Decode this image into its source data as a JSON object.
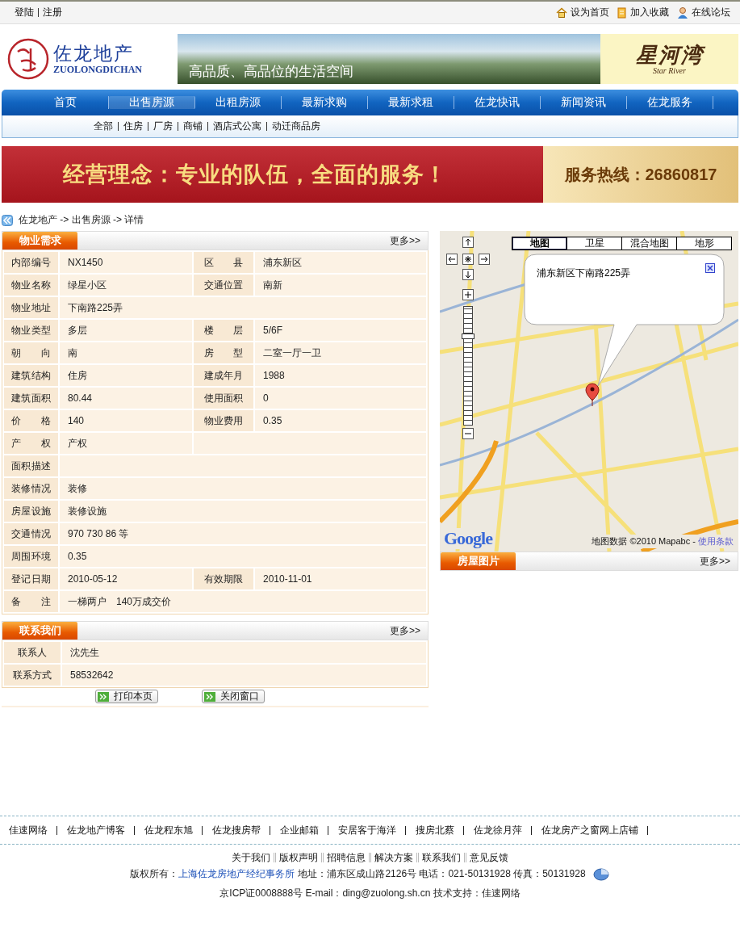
{
  "top_bar": {
    "left_links": [
      "登陆",
      "注册"
    ],
    "right_links": [
      "设为首页",
      "加入收藏",
      "在线论坛"
    ]
  },
  "header": {
    "logo_name": "佐龙地产",
    "logo_pinyin": "ZUOLONGDICHAN",
    "banner_caption": "高品质、高品位的生活空间",
    "brand_name": "星河湾",
    "brand_tagline": "Star River"
  },
  "nav": [
    {
      "label": "首页",
      "selected": false
    },
    {
      "label": "出售房源",
      "selected": true
    },
    {
      "label": "出租房源",
      "selected": false
    },
    {
      "label": "最新求购",
      "selected": false
    },
    {
      "label": "最新求租",
      "selected": false
    },
    {
      "label": "佐龙快讯",
      "selected": false
    },
    {
      "label": "新闻资讯",
      "selected": false
    },
    {
      "label": "佐龙服务",
      "selected": false
    }
  ],
  "sub_nav": [
    "全部",
    "住房",
    "厂房",
    "商铺",
    "酒店式公寓",
    "动迁商品房"
  ],
  "promo_banner": {
    "slogan": "经营理念：专业的队伍，全面的服务！",
    "hotline": "服务热线：26860817"
  },
  "breadcrumb": "佐龙地产 -> 出售房源 -> 详情",
  "property_panel": {
    "title": "物业需求",
    "more": "更多>>",
    "rows": [
      {
        "kind": "pair",
        "label": "内部编号",
        "value": "NX1450",
        "label_2": "区　县",
        "value_2": "浦东新区"
      },
      {
        "kind": "pair",
        "label": "物业名称",
        "value": "绿星小区",
        "label_2": "交通位置",
        "value_2": "南新"
      },
      {
        "kind": "wide",
        "label": "物业地址",
        "value": "下南路225弄"
      },
      {
        "kind": "pair",
        "label": "物业类型",
        "value": "多层",
        "label_2": "楼　层",
        "value_2": "5/6F"
      },
      {
        "kind": "pair",
        "label": "朝　向",
        "value": "南",
        "label_2": "房　型",
        "value_2": "二室一厅一卫"
      },
      {
        "kind": "pair",
        "label": "建筑结构",
        "value": "住房",
        "label_2": "建成年月",
        "value_2": "1988"
      },
      {
        "kind": "pair",
        "label": "建筑面积",
        "value": "80.44",
        "label_2": "使用面积",
        "value_2": "0"
      },
      {
        "kind": "pair",
        "label": "价　格",
        "value": "140",
        "label_2": "物业费用",
        "value_2": "0.35"
      },
      {
        "kind": "half",
        "label": "产　权",
        "value": "产权"
      },
      {
        "kind": "wide",
        "label": "面积描述"
      },
      {
        "kind": "wide",
        "label": "装修情况",
        "value": "装修"
      },
      {
        "kind": "wide",
        "label": "房屋设施",
        "value": "装修设施"
      },
      {
        "kind": "wide",
        "label": "交通情况",
        "value": "970 730 86 等"
      },
      {
        "kind": "wide",
        "label": "周围环境",
        "value": "0.35"
      },
      {
        "kind": "pair",
        "label": "登记日期",
        "value": "2010-05-12",
        "label_2": "有效期限",
        "value_2": "2010-11-01"
      },
      {
        "kind": "wide",
        "label": "备　注",
        "value": "一梯两户　140万成交价"
      }
    ]
  },
  "contact_panel": {
    "title": "联系我们",
    "more": "更多>>",
    "rows": [
      {
        "label": "联系人",
        "value": "沈先生"
      },
      {
        "label": "联系方式",
        "value": "58532642"
      }
    ]
  },
  "buttons": [
    "打印本页",
    "关闭窗口"
  ],
  "map_panel": {
    "map_types": [
      {
        "label": "地图",
        "selected": true
      },
      {
        "label": "卫星",
        "selected": false
      },
      {
        "label": "混合地图",
        "selected": false
      },
      {
        "label": "地形",
        "selected": false
      }
    ],
    "zoom_slider": {
      "level": 0.76
    },
    "info_window": "浦东新区下南路225弄",
    "logo": "Google",
    "attribution": "地图数据 ©2010 Mapabc - ",
    "terms_link": "使用条款"
  },
  "photos_panel": {
    "title": "房屋图片",
    "more": "更多>>"
  },
  "footer": {
    "links": [
      "佳速网络",
      "佐龙地产博客",
      "佐龙程东旭",
      "佐龙搜房帮",
      "企业邮箱",
      "安居客于海洋",
      "搜房北蔡",
      "佐龙徐月萍",
      "佐龙房产之窗网上店铺"
    ],
    "info_links": [
      "关于我们",
      "版权声明",
      "招聘信息",
      "解决方案",
      "联系我们",
      "意见反馈"
    ],
    "copyright_label": "版权所有：",
    "company_link": "上海佐龙房地产经纪事务所",
    "address": "地址：浦东区成山路2126号 电话：021-50131928 传真：50131928",
    "icp": "京ICP证0008888号 E-mail：ding@zuolong.sh.cn 技术支持：佳速网络"
  }
}
